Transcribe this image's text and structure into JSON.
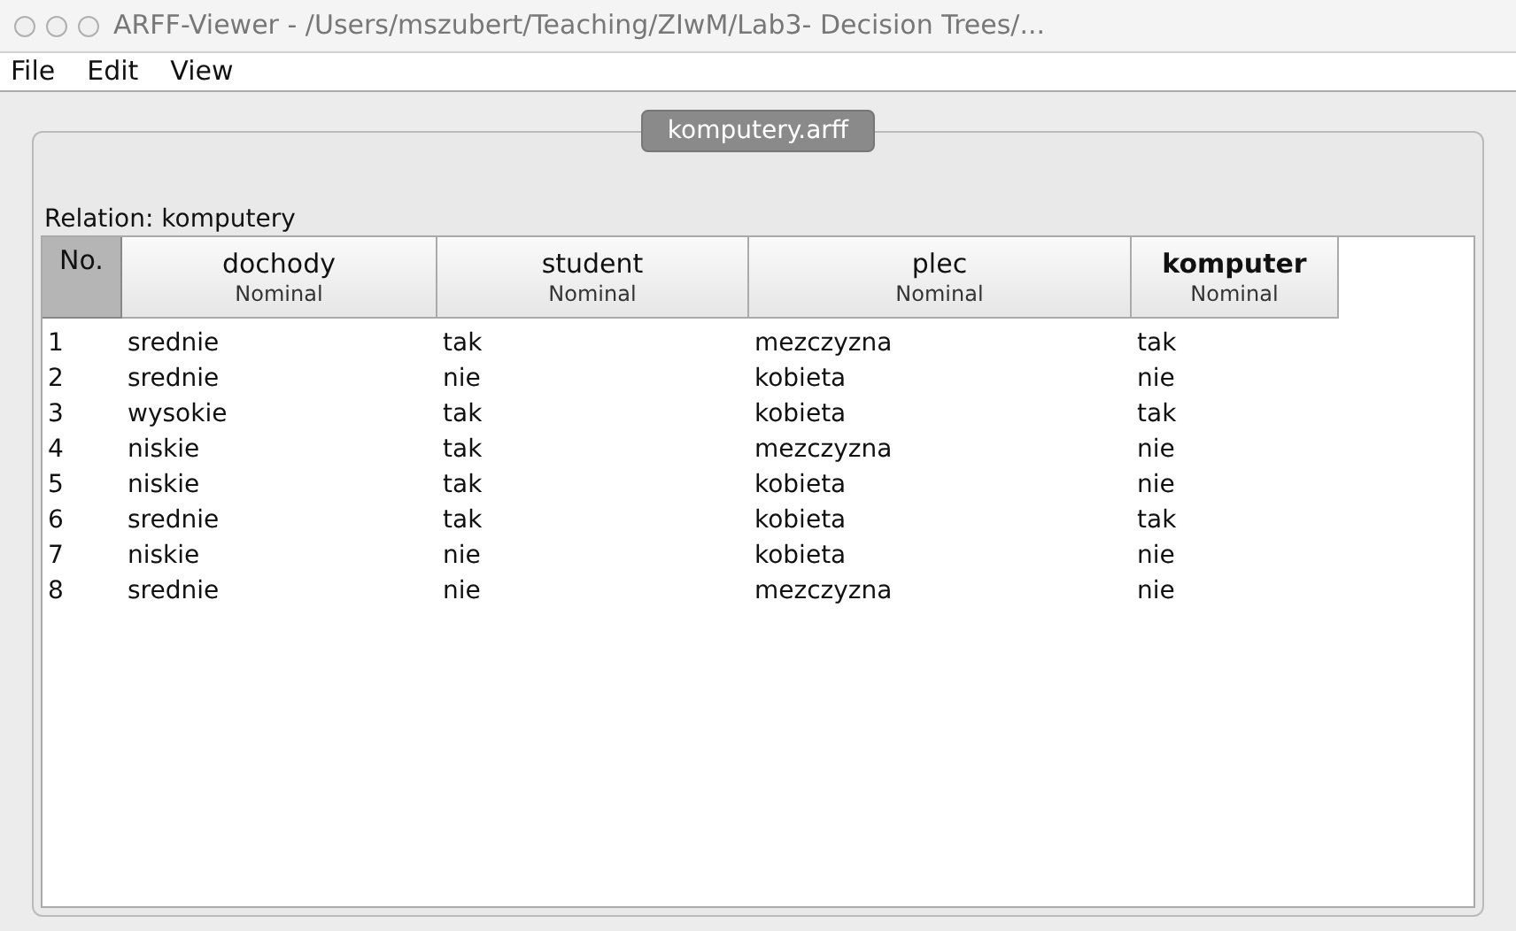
{
  "window": {
    "title": "ARFF-Viewer - /Users/mszubert/Teaching/ZIwM/Lab3- Decision Trees/..."
  },
  "menu": [
    "File",
    "Edit",
    "View"
  ],
  "tabs": [
    {
      "label": "komputery.arff",
      "selected": true
    }
  ],
  "relation": "Relation: komputery",
  "table": {
    "index_column": {
      "label": "No."
    },
    "columns": [
      {
        "name": "dochody",
        "type": "Nominal",
        "is_class": false
      },
      {
        "name": "student",
        "type": "Nominal",
        "is_class": false
      },
      {
        "name": "plec",
        "type": "Nominal",
        "is_class": false
      },
      {
        "name": "komputer",
        "type": "Nominal",
        "is_class": true
      }
    ],
    "rows": [
      [
        "1",
        "srednie",
        "tak",
        "mezczyzna",
        "tak"
      ],
      [
        "2",
        "srednie",
        "nie",
        "kobieta",
        "nie"
      ],
      [
        "3",
        "wysokie",
        "tak",
        "kobieta",
        "tak"
      ],
      [
        "4",
        "niskie",
        "tak",
        "mezczyzna",
        "nie"
      ],
      [
        "5",
        "niskie",
        "tak",
        "kobieta",
        "nie"
      ],
      [
        "6",
        "srednie",
        "tak",
        "kobieta",
        "tak"
      ],
      [
        "7",
        "niskie",
        "nie",
        "kobieta",
        "nie"
      ],
      [
        "8",
        "srednie",
        "nie",
        "mezczyzna",
        "nie"
      ]
    ]
  }
}
